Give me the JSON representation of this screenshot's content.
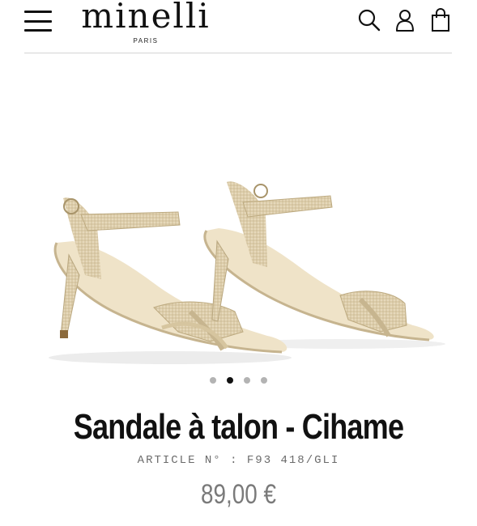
{
  "header": {
    "brand": "minelli",
    "brand_sub": "PARIS",
    "icons": [
      "menu-icon",
      "search-icon",
      "account-icon",
      "shopping-bag-icon"
    ]
  },
  "gallery": {
    "image_alt": "Sandale à talon - Cihame",
    "dots_count": 4,
    "active_dot": 2
  },
  "product": {
    "title": "Sandale à talon - Cihame",
    "article": "ARTICLE N° : F93 418/GLI",
    "price": "89,00 €"
  },
  "colors": {
    "text": "#111111",
    "muted": "#7a7a7a",
    "sandal_gold": "#d9c9a8",
    "dot_inactive": "#b3b3b3"
  }
}
